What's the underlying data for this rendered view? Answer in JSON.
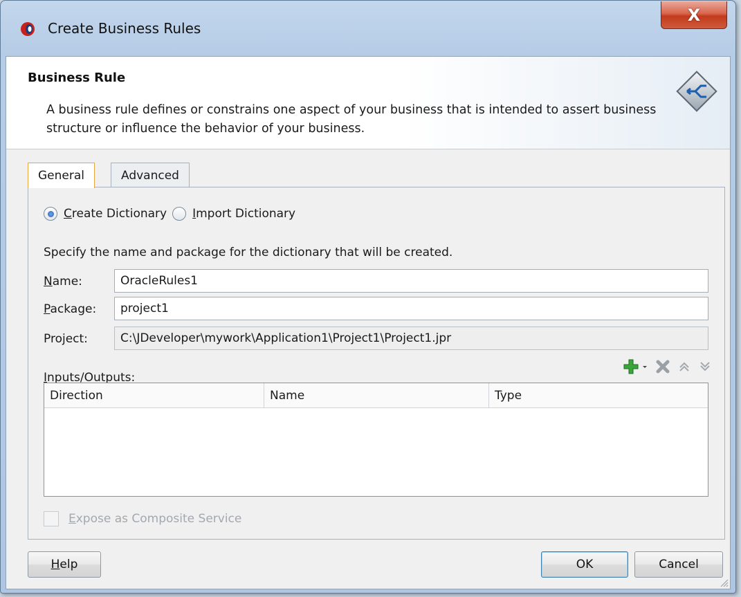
{
  "window": {
    "title": "Create Business Rules",
    "close_label": "X"
  },
  "banner": {
    "title": "Business Rule",
    "description": "A business rule defines or constrains one aspect of your business that is intended to assert business structure or influence the behavior of your business."
  },
  "tabs": [
    {
      "label": "General",
      "active": true
    },
    {
      "label": "Advanced",
      "active": false
    }
  ],
  "general": {
    "radio_create": {
      "mnemonic": "C",
      "rest": "reate Dictionary",
      "selected": true
    },
    "radio_import": {
      "mnemonic": "I",
      "rest": "mport Dictionary",
      "selected": false
    },
    "instruction": "Specify the name and package for the dictionary that will be created.",
    "name": {
      "label_mnemonic": "N",
      "label_rest": "ame:",
      "value": "OracleRules1"
    },
    "package": {
      "label_mnemonic": "P",
      "label_rest": "ackage:",
      "value": "project1"
    },
    "project": {
      "label": "Project:",
      "value": "C:\\JDeveloper\\mywork\\Application1\\Project1\\Project1.jpr"
    },
    "io": {
      "label_mnemonic": "I",
      "label_rest": "nputs/Outputs:",
      "columns": [
        "Direction",
        "Name",
        "Type"
      ]
    },
    "expose": {
      "mnemonic": "E",
      "rest": "xpose as Composite Service",
      "checked": false,
      "enabled": false
    }
  },
  "buttons": {
    "help_mnemonic": "H",
    "help_rest": "elp",
    "ok": "OK",
    "cancel": "Cancel"
  },
  "colors": {
    "active_tab_border": "#e8a53b",
    "add_icon": "#3aa53a",
    "close_button": "#c23a1c"
  }
}
